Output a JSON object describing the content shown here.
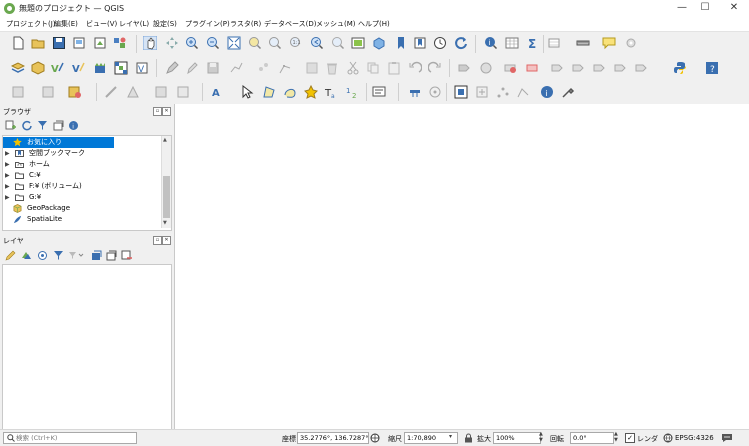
{
  "window": {
    "title": "無題のプロジェクト — QGIS"
  },
  "window_controls": {
    "minimize": "—",
    "maximize": "☐",
    "close": "✕"
  },
  "menu": [
    "プロジェクト(J)",
    "編集(E)",
    "ビュー(V)",
    "レイヤ(L)",
    "設定(S)",
    "プラグイン(P)",
    "ラスタ(R)",
    "データベース(D)",
    "メッシュ(M)",
    "ヘルプ(H)"
  ],
  "browser": {
    "title": "ブラウザ",
    "items": [
      {
        "label": "お気に入り",
        "icon": "star-icon",
        "expandable": false,
        "selected": true
      },
      {
        "label": "空間ブックマーク",
        "icon": "bookmark-icon",
        "expandable": true
      },
      {
        "label": "ホーム",
        "icon": "home-folder-icon",
        "expandable": true
      },
      {
        "label": "C:¥",
        "icon": "folder-icon",
        "expandable": true
      },
      {
        "label": "F:¥ (ボリューム)",
        "icon": "folder-icon",
        "expandable": true
      },
      {
        "label": "G:¥",
        "icon": "folder-icon",
        "expandable": true
      },
      {
        "label": "GeoPackage",
        "icon": "geopackage-icon",
        "expandable": false
      },
      {
        "label": "SpatiaLite",
        "icon": "spatialite-icon",
        "expandable": false
      }
    ]
  },
  "layers": {
    "title": "レイヤ"
  },
  "panel_buttons": {
    "float": "▫",
    "close": "✕"
  },
  "status": {
    "search_placeholder": "検索 (Ctrl+K)",
    "coord_label": "座標",
    "coord_value": "35.2776°, 136.7287°",
    "scale_label": "縮尺",
    "scale_value": "1:70,890",
    "magnifier_label": "拡大",
    "magnifier_value": "100%",
    "rotation_label": "回転",
    "rotation_value": "0.0°",
    "render_label": "レンダ",
    "crs_label": "EPSG:4326"
  },
  "colors": {
    "selection": "#0078d7",
    "folder": "#e8c35a",
    "accent_green": "#6aa84f",
    "star": "#f2c200"
  }
}
